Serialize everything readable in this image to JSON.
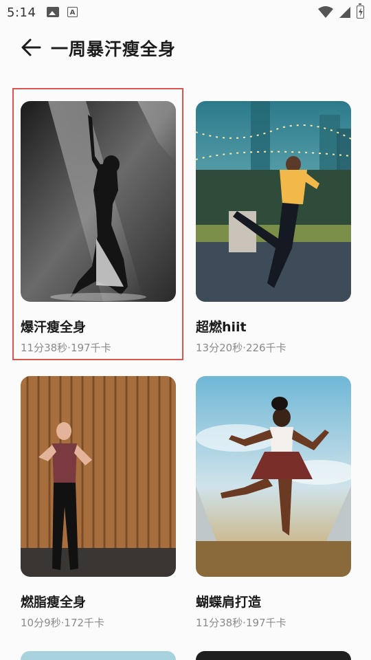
{
  "status_bar": {
    "time": "5:14",
    "icons": [
      "photo-icon",
      "a-badge-icon",
      "wifi-icon",
      "signal-icon",
      "battery-charging-icon"
    ]
  },
  "header": {
    "title": "一周暴汗瘦全身",
    "back_icon": "arrow-left-icon"
  },
  "colors": {
    "highlight_border": "#d9534f",
    "meta_text": "#8a8a8a"
  },
  "cards": [
    {
      "title": "爆汗瘦全身",
      "meta": "11分38秒·197千卡"
    },
    {
      "title": "超燃hiit",
      "meta": "13分20秒·226千卡"
    },
    {
      "title": "燃脂瘦全身",
      "meta": "10分9秒·172千卡"
    },
    {
      "title": "蝴蝶肩打造",
      "meta": "11分38秒·197千卡"
    }
  ]
}
